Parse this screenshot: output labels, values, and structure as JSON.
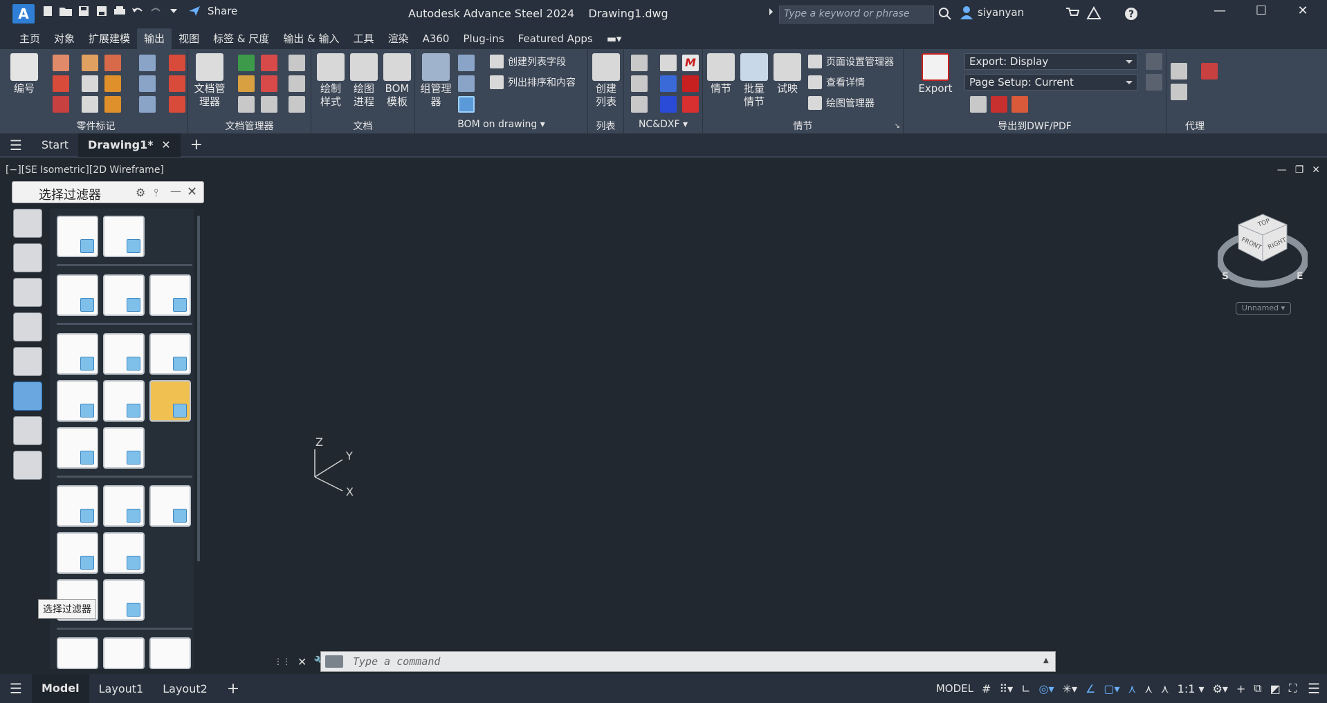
{
  "app_title": "Autodesk Advance Steel 2024",
  "doc_title": "Drawing1.dwg",
  "share_label": "Share",
  "search_placeholder": "Type a keyword or phrase",
  "user_name": "siyanyan",
  "menu_tabs": [
    "主页",
    "对象",
    "扩展建模",
    "输出",
    "视图",
    "标签 & 尺度",
    "输出 & 输入",
    "工具",
    "渲染",
    "A360",
    "Plug-ins",
    "Featured Apps"
  ],
  "active_menu": "输出",
  "ribbon": {
    "panels": [
      "零件标记",
      "文档管理器",
      "文档",
      "BOM on drawing",
      "列表",
      "NC&DXF",
      "情节",
      "导出到DWF/PDF",
      "代理"
    ],
    "numbering_label": "编号",
    "doc_manager_label": "文档管理器",
    "draw_style_label": "绘制样式",
    "draw_process_label": "绘图进程",
    "bom_template_label": "BOM模板",
    "group_manager_label": "组管理器",
    "create_field_label": "创建列表字段",
    "sort_content_label": "列出排序和内容",
    "create_list_label": "创建列表",
    "plot_label": "情节",
    "batch_plot_label": "批量情节",
    "preview_label": "试映",
    "page_setup_manager_label": "页面设置管理器",
    "view_details_label": "查看详情",
    "plotter_manager_label": "绘图管理器",
    "export_label": "Export",
    "export_display": "Export: Display",
    "page_setup_current": "Page Setup: Current"
  },
  "doc_tabs": [
    "Start",
    "Drawing1*"
  ],
  "active_doc_tab": "Drawing1*",
  "viewport_label": "[−][SE Isometric][2D Wireframe]",
  "palette_title": "选择过滤器",
  "tooltip": "选择过滤器",
  "viewcube": {
    "top": "TOP",
    "front": "FRONT",
    "right": "RIGHT",
    "s": "S",
    "e": "E",
    "ucs": "Unnamed"
  },
  "ucs_axes": {
    "x": "X",
    "y": "Y",
    "z": "Z"
  },
  "command_placeholder": "Type a command",
  "layout_tabs": [
    "Model",
    "Layout1",
    "Layout2"
  ],
  "active_layout": "Model",
  "status_items": {
    "model": "MODEL",
    "scale": "1:1"
  }
}
